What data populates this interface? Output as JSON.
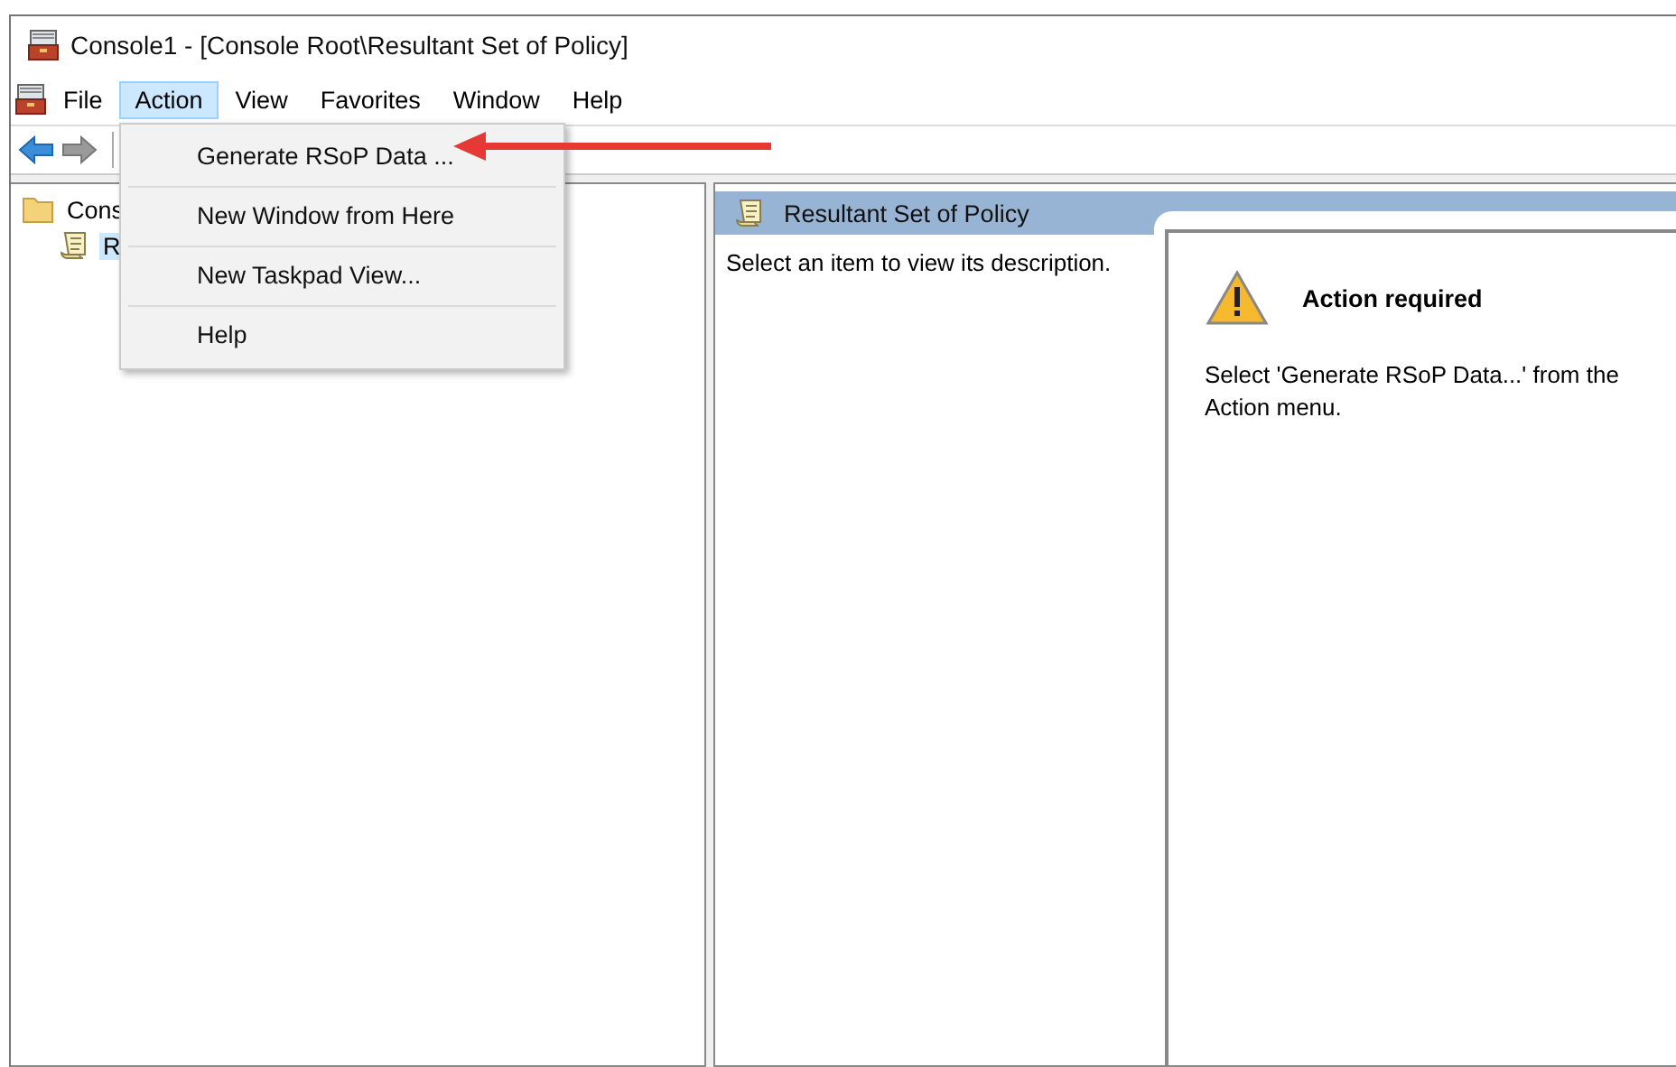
{
  "window": {
    "title": "Console1 - [Console Root\\Resultant Set of Policy]"
  },
  "menu_bar": [
    {
      "label": "File",
      "selected": false
    },
    {
      "label": "Action",
      "selected": true
    },
    {
      "label": "View",
      "selected": false
    },
    {
      "label": "Favorites",
      "selected": false
    },
    {
      "label": "Window",
      "selected": false
    },
    {
      "label": "Help",
      "selected": false
    }
  ],
  "action_menu": {
    "items": [
      {
        "label": "Generate RSoP Data ..."
      },
      {
        "label": "New Window from Here"
      },
      {
        "label": "New Taskpad View..."
      },
      {
        "label": "Help"
      }
    ]
  },
  "tree": {
    "items": [
      {
        "label": "Cons",
        "selected": false,
        "children": [
          {
            "label": "R",
            "selected": true
          }
        ]
      }
    ]
  },
  "details": {
    "title": "Resultant Set of Policy",
    "description": "Select an item to view its description.",
    "notice": {
      "heading": "Action required",
      "message": "Select 'Generate RSoP Data...' from the Action menu."
    }
  }
}
